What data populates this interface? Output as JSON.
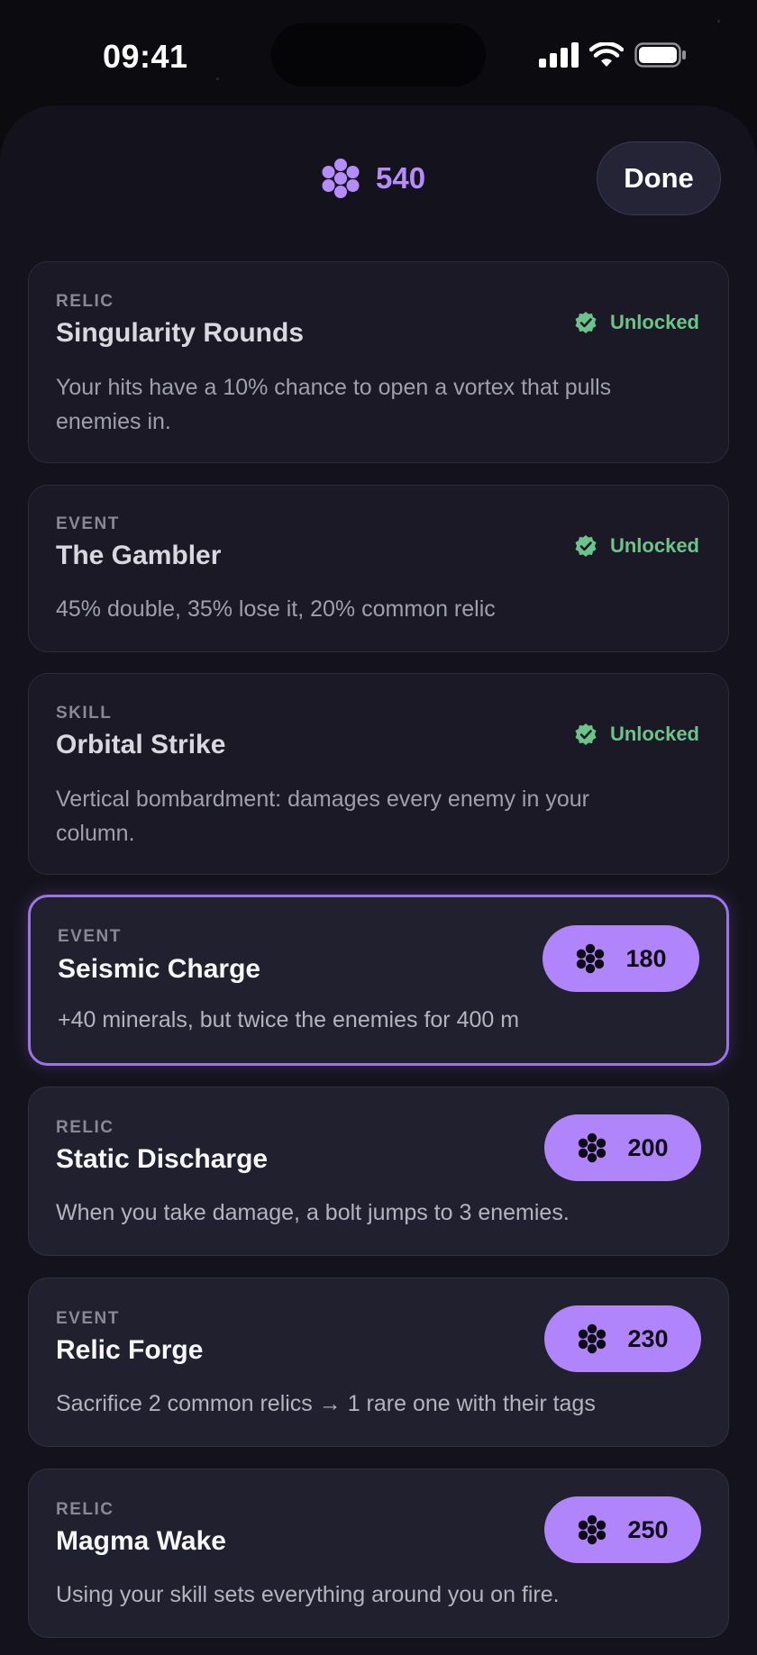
{
  "status_bar": {
    "time": "09:41"
  },
  "header": {
    "coins": "540",
    "done_label": "Done"
  },
  "colors": {
    "accent": "#b084fb",
    "unlocked": "#6cc48a",
    "background": "#14131d"
  },
  "items": [
    {
      "category": "RELIC",
      "title": "Singularity Rounds",
      "description": "Your hits have a 10% chance to open a vortex that pulls enemies in.",
      "status": "Unlocked"
    },
    {
      "category": "EVENT",
      "title": "The Gambler",
      "description": "45% double, 35% lose it, 20% common relic",
      "status": "Unlocked"
    },
    {
      "category": "SKILL",
      "title": "Orbital Strike",
      "description": "Vertical bombardment: damages every enemy in your column.",
      "status": "Unlocked"
    },
    {
      "category": "EVENT",
      "title": "Seismic Charge",
      "description": "+40 minerals, but twice the enemies for 400 m",
      "price": "180",
      "selected": true
    },
    {
      "category": "RELIC",
      "title": "Static Discharge",
      "description": "When you take damage, a bolt jumps to 3 enemies.",
      "price": "200"
    },
    {
      "category": "EVENT",
      "title": "Relic Forge",
      "description": "Sacrifice 2 common relics → 1 rare one with their tags",
      "price": "230"
    },
    {
      "category": "RELIC",
      "title": "Magma Wake",
      "description": "Using your skill sets everything around you on fire.",
      "price": "250"
    }
  ]
}
